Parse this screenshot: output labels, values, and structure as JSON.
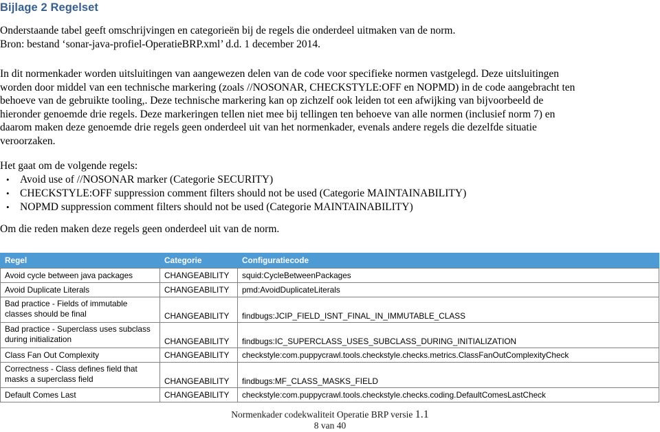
{
  "document": {
    "title": "Bijlage 2 Regelset",
    "title_color": "#375F92"
  },
  "intro": {
    "line1": "Onderstaande tabel geeft omschrijvingen en categorieën bij de regels die onderdeel uitmaken van de norm.",
    "line2": "Bron: bestand ‘sonar-java-profiel-OperatieBRP.xml’ d.d. 1 december 2014."
  },
  "paragraph": {
    "line1": "In dit normenkader worden uitsluitingen van aangewezen delen van de code voor specifieke normen vastgelegd. Deze uitsluitingen",
    "line2": "worden door middel van een technische markering (zoals //NOSONAR, CHECKSTYLE:OFF en NOPMD) in de code aangebracht ten",
    "line3": "behoeve van de gebruikte tooling,.  Deze technische markering kan op zichzelf ook leiden tot een afwijking van bijvoorbeeld de",
    "line4": "hieronder genoemde drie regels. Deze markeringen tellen niet mee bij tellingen ten behoeve van alle normen (inclusief norm 7) en",
    "line5": "daarom maken deze genoemde drie regels geen onderdeel uit van het normenkader, evenals andere regels die dezelfde situatie",
    "line6": "veroorzaken."
  },
  "list": {
    "leadin": "Het gaat om de volgende regels:",
    "bullet_glyph": "•",
    "items": [
      "Avoid use of //NOSONAR marker (Categorie SECURITY)",
      "CHECKSTYLE:OFF suppression comment filters should not be used (Categorie MAINTAINABILITY)",
      "NOPMD suppression comment filters should not be used (Categorie MAINTAINABILITY)"
    ],
    "closing": "Om die reden maken deze regels geen onderdeel uit van de norm."
  },
  "table": {
    "header_bg": "#4E9AD4",
    "headers": [
      "Regel",
      "Categorie",
      "Configuratiecode"
    ],
    "rows": [
      {
        "regel": [
          "Avoid cycle between java packages"
        ],
        "categorie": "CHANGEABILITY",
        "code": "squid:CycleBetweenPackages",
        "lines": 1
      },
      {
        "regel": [
          "Avoid Duplicate Literals"
        ],
        "categorie": "CHANGEABILITY",
        "code": "pmd:AvoidDuplicateLiterals",
        "lines": 1
      },
      {
        "regel": [
          "Bad practice - Fields of immutable",
          "classes should be final"
        ],
        "categorie": "CHANGEABILITY",
        "code": "findbugs:JCIP_FIELD_ISNT_FINAL_IN_IMMUTABLE_CLASS",
        "lines": 2
      },
      {
        "regel": [
          "Bad practice - Superclass uses subclass",
          "during initialization"
        ],
        "categorie": "CHANGEABILITY",
        "code": "findbugs:IC_SUPERCLASS_USES_SUBCLASS_DURING_INITIALIZATION",
        "lines": 2
      },
      {
        "regel": [
          "Class Fan Out Complexity"
        ],
        "categorie": "CHANGEABILITY",
        "code": "checkstyle:com.puppycrawl.tools.checkstyle.checks.metrics.ClassFanOutComplexityCheck",
        "lines": 1
      },
      {
        "regel": [
          "Correctness - Class defines field that",
          "masks a superclass field"
        ],
        "categorie": "CHANGEABILITY",
        "code": "findbugs:MF_CLASS_MASKS_FIELD",
        "lines": 2
      },
      {
        "regel": [
          "Default Comes Last"
        ],
        "categorie": "CHANGEABILITY",
        "code": "checkstyle:com.puppycrawl.tools.checkstyle.checks.coding.DefaultComesLastCheck",
        "lines": 1
      }
    ]
  },
  "footer": {
    "text": "Normenkader codekwaliteit Operatie BRP versie",
    "version": "1.1",
    "page": "8 van 40"
  }
}
